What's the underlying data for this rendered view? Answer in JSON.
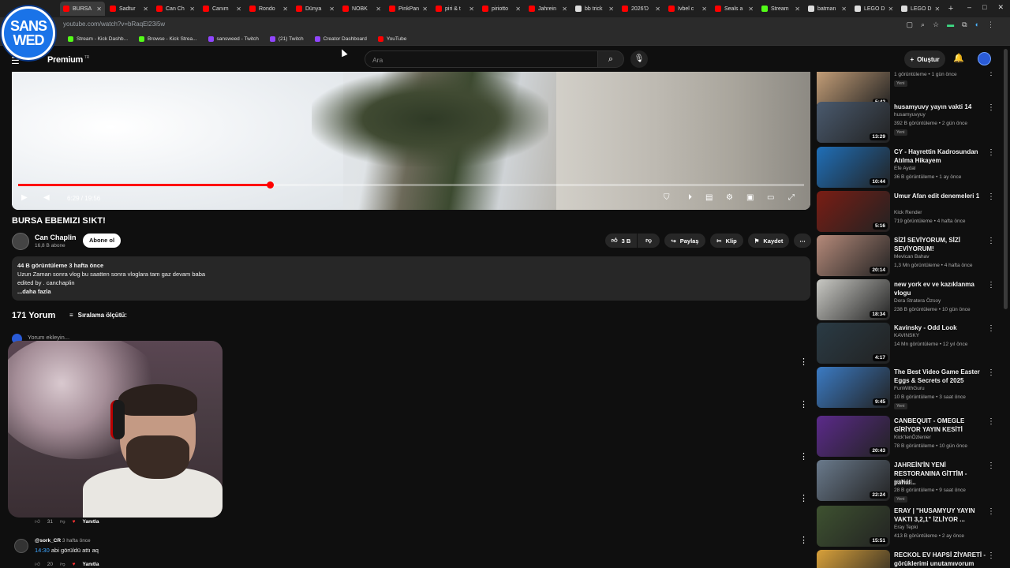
{
  "browser": {
    "tabs": [
      "BURSA",
      "Sadtur",
      "Can Ch",
      "Canım",
      "Rondo",
      "Dünya",
      "NOBK",
      "PinkPan",
      "piri & t",
      "piriotto",
      "Jahrein",
      "bb trick",
      "2026'D",
      "Ivbel c",
      "Seals a",
      "Stream",
      "batman",
      "LEGO D",
      "LEGO D"
    ],
    "new_tab": "+",
    "url": "youtube.com/watch?v=bRaqEl23i5w",
    "bookmarks": [
      "Stream - Kick Dashb...",
      "Browse - Kick Strea...",
      "sansweed - Twitch",
      "(21) Twitch",
      "Creator Dashboard",
      "YouTube"
    ],
    "win_controls": [
      "–",
      "□",
      "✕"
    ],
    "addr_icons": [
      "▢",
      "⌕",
      "☆",
      "▬",
      "⧉",
      "◐",
      "⋮"
    ]
  },
  "stream_logo": {
    "line1": "SANS",
    "line2": "WED"
  },
  "header": {
    "logo_text": "Premium",
    "logo_sup": "TR",
    "search_placeholder": "Ara",
    "create_label": "Oluştur"
  },
  "video": {
    "progress": 0.32,
    "time": "6:29 / 19:56",
    "title": "BURSA EBEMIZI S!KT!"
  },
  "channel": {
    "name": "Can Chaplin",
    "subs": "16,8 B abone",
    "subscribe": "Abone ol"
  },
  "actions": {
    "likes": "3 B",
    "share": "Paylaş",
    "clip": "Klip",
    "save": "Kaydet"
  },
  "description": {
    "stats": "44 B görüntüleme  3 hafta önce",
    "line1": "Uzun Zaman sonra vlog bu saatten sonra vloglara tam gaz devam baba",
    "line2": "edited by . canchaplin",
    "more": "...daha fazla"
  },
  "comments": {
    "count": "171 Yorum",
    "sort": "Sıralama ölçütü:",
    "add_placeholder": "Yorum ekleyin...",
    "c1_likes": "31",
    "reply": "Yanıtla",
    "c2_author": "@sork_CR",
    "c2_time": "3 hafta önce",
    "c2_ts": "14:30",
    "c2_text": "abi görüldü attı aq",
    "c2_likes": "20"
  },
  "recommendations": [
    {
      "title": "",
      "channel": "",
      "meta": "1 görüntüleme • 1 gün önce",
      "badge": "Yeni",
      "duration": "5:42",
      "color": "#c9a27a"
    },
    {
      "title": "husamyuvy yayın vakti 14",
      "channel": "husamyuvyuy",
      "meta": "392 B görüntüleme • 2 gün önce",
      "badge": "Yeni",
      "duration": "13:29",
      "color": "#4a5a6e"
    },
    {
      "title": "CY - Hayrettin Kadrosundan Atılma Hikayem",
      "channel": "Efe Aydal",
      "meta": "36 B görüntüleme • 1 ay önce",
      "badge": "",
      "duration": "10:44",
      "color": "#1f6fb8"
    },
    {
      "title": "Umur Afan edit denemeleri 1",
      "channel": "Kick Render",
      "meta": "719 görüntüleme • 4 hafta önce",
      "badge": "",
      "duration": "5:16",
      "color": "#7a1d14"
    },
    {
      "title": "SİZİ SEVİYORUM, SİZİ SEVİYORUM!",
      "channel": "Mevlcan Bahav",
      "meta": "1,3 Mn görüntüleme • 4 hafta önce",
      "badge": "",
      "duration": "20:14",
      "color": "#b58a7a"
    },
    {
      "title": "new york ev ve kazıklanma vlogu",
      "channel": "Dora Stratera Özsoy",
      "meta": "238 B görüntüleme • 10 gün önce",
      "badge": "",
      "duration": "18:34",
      "color": "#c9c9c4"
    },
    {
      "title": "Kavinsky - Odd Look",
      "channel": "KAVINSKY",
      "meta": "14 Mn görüntüleme • 12 yıl önce",
      "badge": "",
      "duration": "4:17",
      "color": "#2a3b45"
    },
    {
      "title": "The Best Video Game Easter Eggs & Secrets of 2025",
      "channel": "FunWithGuru",
      "meta": "10 B görüntüleme • 3 saat önce",
      "badge": "Yeni",
      "duration": "9:45",
      "color": "#3b7bc4"
    },
    {
      "title": "CANBEQUIT - OMEGLE GİRİYOR YAYIN KESİTİ",
      "channel": "Kick'tenÖzlenler",
      "meta": "78 B görüntüleme • 10 gün önce",
      "badge": "",
      "duration": "20:43",
      "color": "#5b2a8a"
    },
    {
      "title": "JAHREİN'İN YENİ RESTORANINA GİTTİM - pahal...",
      "channel": "emirVici",
      "meta": "28 B görüntüleme • 9 saat önce",
      "badge": "Yeni",
      "duration": "22:24",
      "color": "#6a7a8c"
    },
    {
      "title": "ERAY | \"HUSAMYUY YAYIN VAKTI 3,2,1\" İZLİYOR ...",
      "channel": "Eray Tepki",
      "meta": "413 B görüntüleme • 2 ay önce",
      "badge": "",
      "duration": "15:51",
      "color": "#3e5230"
    },
    {
      "title": "RECKOL EV HAPSİ ZİYARETİ - görüklerimi unutamıvorum",
      "channel": "",
      "meta": "",
      "badge": "",
      "duration": "",
      "color": "#d9a13a"
    }
  ]
}
